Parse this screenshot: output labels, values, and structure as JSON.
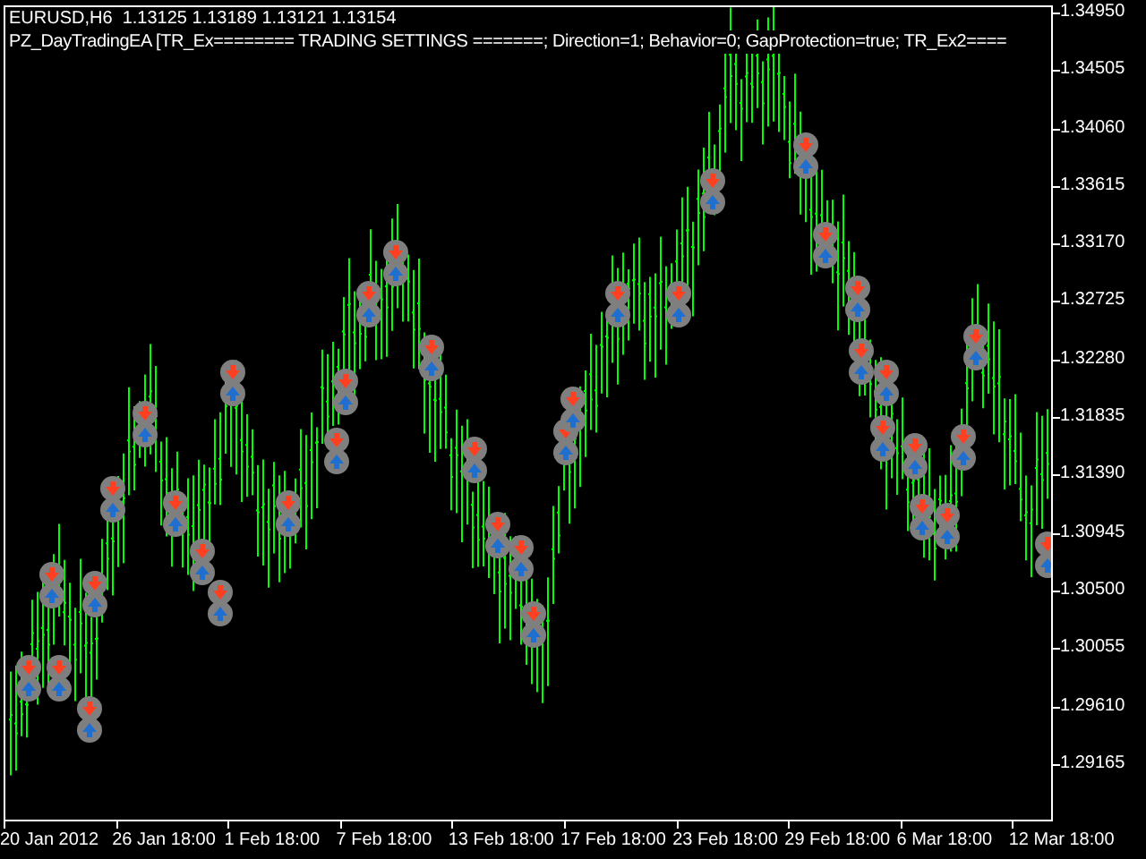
{
  "chart": {
    "symbol_info": "EURUSD,H6  1.13125 1.13189 1.13121 1.13154",
    "indicator_label": "PZ_DayTradingEA [TR_Ex======== TRADING SETTINGS =======; Direction=1; Behavior=0; GapProtection=true; TR_Ex2====",
    "price_axis": [
      "1.34950",
      "1.34505",
      "1.34060",
      "1.33615",
      "1.33170",
      "1.32725",
      "1.32280",
      "1.31835",
      "1.31390",
      "1.30945",
      "1.30500",
      "1.30055",
      "1.29610",
      "1.29165"
    ],
    "time_axis": [
      "20 Jan 2012",
      "26 Jan 18:00",
      "1 Feb 18:00",
      "7 Feb 18:00",
      "13 Feb 18:00",
      "17 Feb 18:00",
      "23 Feb 18:00",
      "29 Feb 18:00",
      "6 Mar 18:00",
      "12 Mar 18:00"
    ]
  }
}
